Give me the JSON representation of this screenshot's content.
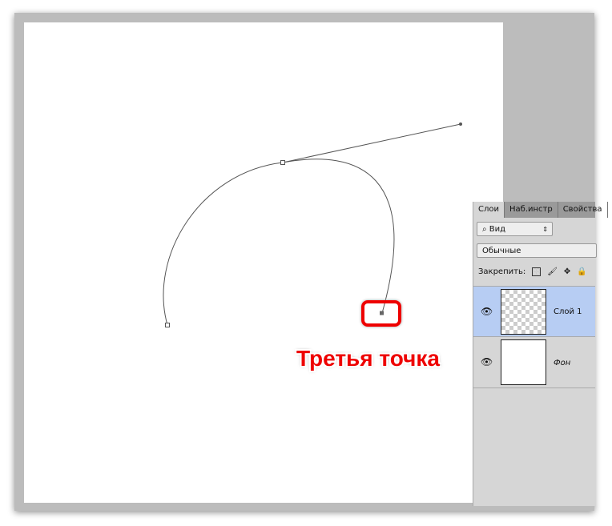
{
  "annotation": {
    "label": "Третья точка",
    "color": "#e00000"
  },
  "panel": {
    "tabs": [
      {
        "label": "Слои",
        "active": true
      },
      {
        "label": "Наб.инстр"
      },
      {
        "label": "Свойства"
      }
    ],
    "filter": {
      "icon": "search-icon",
      "value": "Вид"
    },
    "blend_mode": "Обычные",
    "lock_label": "Закрепить:",
    "layers": [
      {
        "name": "Слой 1",
        "selected": true,
        "transparent": true
      },
      {
        "name": "Фон",
        "selected": false,
        "transparent": false
      }
    ]
  }
}
